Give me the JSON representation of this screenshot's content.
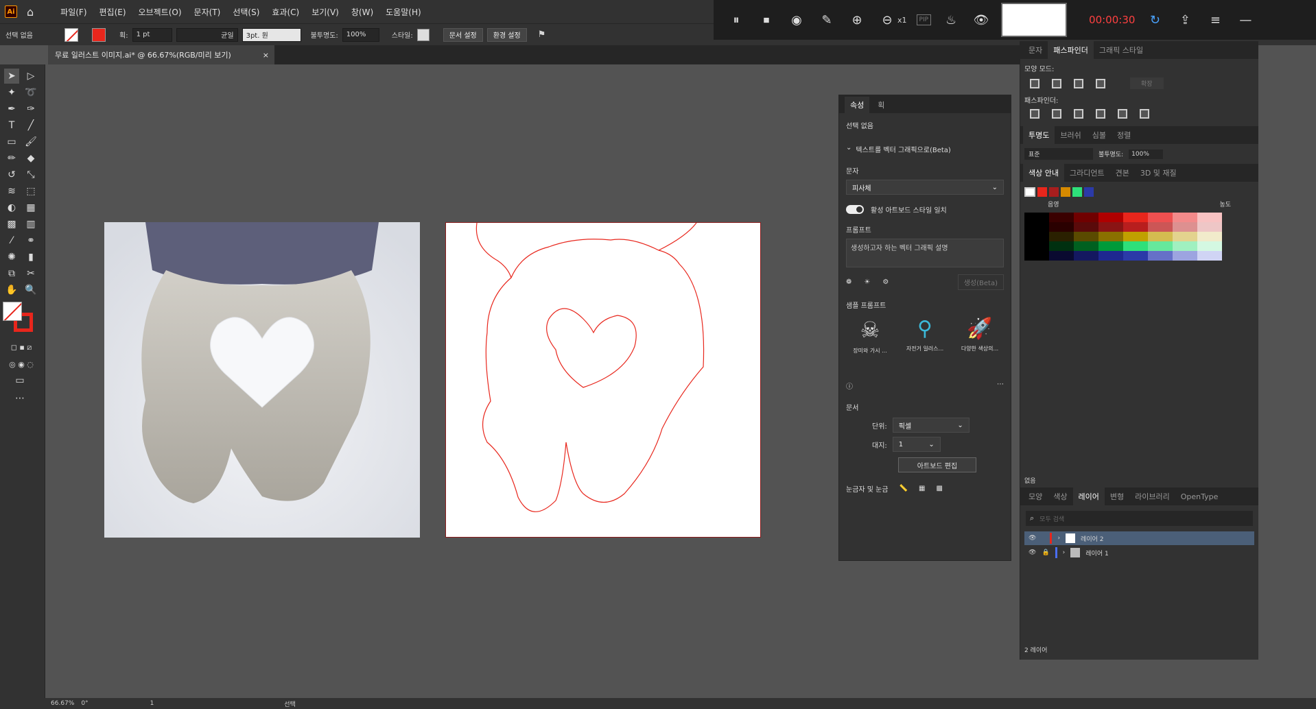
{
  "menubar": {
    "logo": "Ai",
    "menus": [
      "파일(F)",
      "편집(E)",
      "오브젝트(O)",
      "문자(T)",
      "선택(S)",
      "효과(C)",
      "보기(V)",
      "창(W)",
      "도움말(H)"
    ]
  },
  "recorder": {
    "timer": "00:00:30",
    "zoom_suffix": "x1",
    "pip": "PIP"
  },
  "control_bar": {
    "selection": "선택 없음",
    "stroke_label": "획:",
    "stroke_value": "1 pt",
    "stroke_style": "균일",
    "brush": "3pt. 원",
    "opacity_label": "불투명도:",
    "opacity_value": "100%",
    "style_label": "스타일:",
    "doc_setup": "문서 설정",
    "prefs": "환경 설정"
  },
  "document_tab": {
    "title": "무료 일러스트 이미지.ai* @ 66.67%(RGB/미리 보기)",
    "close": "×"
  },
  "properties": {
    "tabs": [
      "속성",
      "획"
    ],
    "no_selection": "선택 없음",
    "text_to_vector": "텍스트를 벡터 그래픽으로(Beta)",
    "subject_label": "문자",
    "subject_value": "피사체",
    "toggle_label": "활성 아트보드 스타일 일치",
    "prompt_label": "프롬프트",
    "prompt_placeholder": "생성하고자 하는 벡터 그래픽 설명",
    "generate": "생성(Beta)",
    "samples_label": "샘플 프롬프트",
    "samples": [
      "장미와 가시 ...",
      "자전거 일러스...",
      "다양한 색상의..."
    ],
    "document_label": "문서",
    "units_label": "단위:",
    "units_value": "픽셀",
    "artboard_label": "대지:",
    "artboard_value": "1",
    "edit_artboards": "아트보드 편집",
    "rulers_label": "눈금자 및 눈금"
  },
  "right_panel": {
    "top_tabs": [
      "문자",
      "패스파인더",
      "그래픽 스타일"
    ],
    "shape_modes": "모양 모드:",
    "expand": "확장",
    "pathfinders": "패스파인더:",
    "trans_tabs": [
      "투명도",
      "브러쉬",
      "심볼",
      "정렬"
    ],
    "blend_mode": "표준",
    "opacity_label": "불투명도:",
    "opacity_value": "100%",
    "guide_tabs": [
      "색상 안내",
      "그라디언트",
      "견본",
      "3D 및 재질"
    ],
    "shade_label": "음영",
    "saturation_label": "농도",
    "none_label": "없음",
    "layer_tabs": [
      "모양",
      "색상",
      "레이어",
      "변형",
      "라이브러리",
      "OpenType"
    ],
    "search_placeholder": "모두 검색",
    "layers": [
      "레이어 2",
      "레이어 1"
    ],
    "layer_count": "2 레이어"
  },
  "status": {
    "zoom": "66.67%",
    "rotate": "0°",
    "artboard": "1",
    "tool": "선택"
  },
  "colors": {
    "accent": "#e8261c",
    "panel": "#323232",
    "bg": "#535353"
  }
}
